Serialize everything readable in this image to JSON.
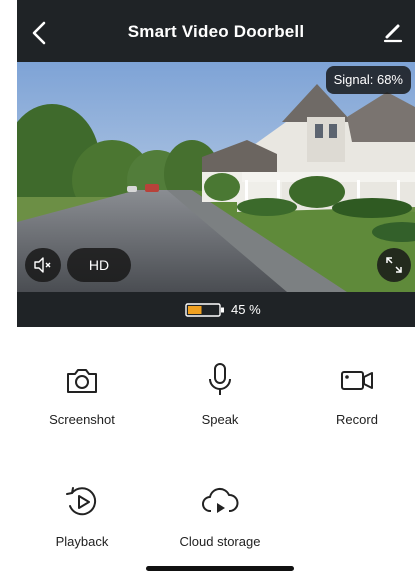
{
  "header": {
    "title": "Smart Video Doorbell"
  },
  "video": {
    "signal_text": "Signal: 68%",
    "quality_label": "HD"
  },
  "status": {
    "battery_level": 0.45,
    "battery_text": "45 %",
    "battery_color": "#f0a020"
  },
  "actions": [
    {
      "label": "Screenshot",
      "icon": "camera-icon"
    },
    {
      "label": "Speak",
      "icon": "microphone-icon"
    },
    {
      "label": "Record",
      "icon": "video-camera-icon"
    },
    {
      "label": "Playback",
      "icon": "playback-icon"
    },
    {
      "label": "Cloud storage",
      "icon": "cloud-play-icon"
    }
  ]
}
